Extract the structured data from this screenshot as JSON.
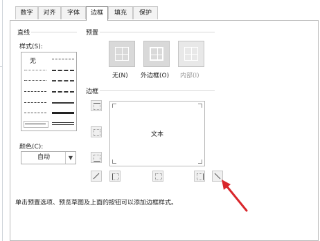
{
  "tabs": [
    {
      "label": "数字"
    },
    {
      "label": "对齐"
    },
    {
      "label": "字体"
    },
    {
      "label": "边框",
      "active": true
    },
    {
      "label": "填充"
    },
    {
      "label": "保护"
    }
  ],
  "line_section": {
    "title": "直线",
    "style_label": "样式(S):",
    "none_label": "无",
    "color_label": "颜色(C):",
    "color_value": "自动"
  },
  "presets_section": {
    "title": "预置",
    "items": [
      {
        "label": "无(N)",
        "icon": "no-border-icon"
      },
      {
        "label": "外边框(O)",
        "icon": "outline-border-icon"
      },
      {
        "label": "内部(I)",
        "icon": "inside-border-icon",
        "disabled": true
      }
    ]
  },
  "border_section": {
    "title": "边框",
    "preview_text": "文本"
  },
  "hint": "单击预置选项、预览草图及上面的按钮可以添加边框样式。",
  "colors": {
    "arrow": "#d9262b",
    "preset_fill": "#d9d9d9"
  }
}
